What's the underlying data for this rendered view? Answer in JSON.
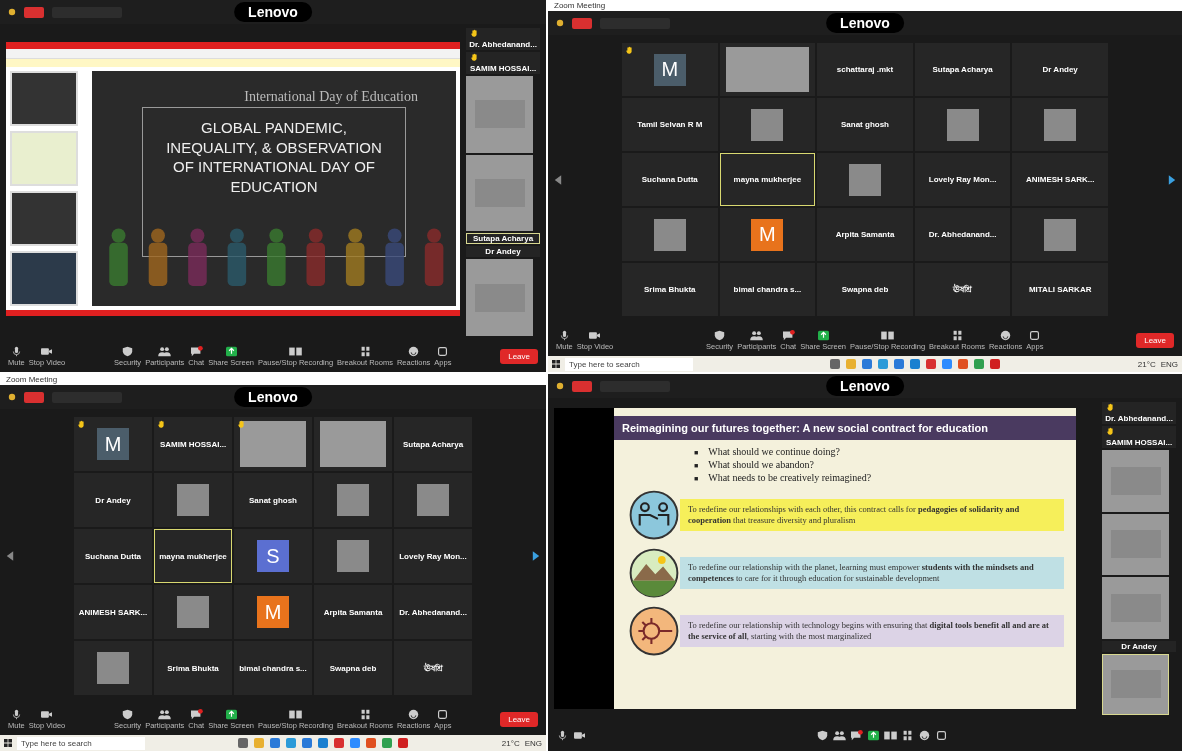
{
  "panels": [
    {
      "kind": "presentation",
      "brand": "Lenovo",
      "slide": {
        "kicker": "International Day of Education",
        "heading": "GLOBAL PANDEMIC, INEQUALITY, & OBSERVATION OF INTERNATIONAL DAY OF EDUCATION"
      },
      "sidebar": [
        {
          "kind": "name",
          "name": "Dr. Abhedanand...",
          "hand": true,
          "selected": false
        },
        {
          "kind": "name",
          "name": "SAMIM HOSSAI...",
          "hand": true,
          "selected": false
        },
        {
          "kind": "video",
          "hand": false,
          "selected": false
        },
        {
          "kind": "video",
          "hand": false,
          "selected": false
        },
        {
          "kind": "name",
          "name": "Sutapa Acharya",
          "hand": false,
          "selected": true
        },
        {
          "kind": "name",
          "name": "Dr Andey",
          "hand": false,
          "selected": false
        },
        {
          "kind": "video",
          "hand": false,
          "selected": false
        }
      ],
      "toolbar": [
        "Mute",
        "Stop Video",
        "Security",
        "Participants",
        "Chat",
        "Share Screen",
        "Pause/Stop Recording",
        "Breakout Rooms",
        "Reactions",
        "Apps"
      ],
      "leave": "Leave"
    },
    {
      "kind": "gallery",
      "title": "Zoom Meeting",
      "brand": "Lenovo",
      "tiles": [
        {
          "kind": "avatar",
          "letter": "M",
          "color": "#4b5d6a",
          "hand": true,
          "selected": false
        },
        {
          "kind": "video",
          "hand": false,
          "selected": false
        },
        {
          "kind": "name",
          "name": "schattaraj .mkt",
          "hand": false,
          "selected": false
        },
        {
          "kind": "name",
          "name": "Sutapa Acharya",
          "hand": false,
          "selected": false
        },
        {
          "kind": "name",
          "name": "Dr Andey",
          "hand": false,
          "selected": false
        },
        {
          "kind": "name",
          "name": "Tamil Selvan R M",
          "hand": false,
          "selected": false
        },
        {
          "kind": "photo",
          "hand": false,
          "selected": false
        },
        {
          "kind": "name",
          "name": "Sanat ghosh",
          "hand": false,
          "selected": false
        },
        {
          "kind": "photo",
          "hand": false,
          "selected": false
        },
        {
          "kind": "photo",
          "hand": false,
          "selected": false
        },
        {
          "kind": "name",
          "name": "Suchana Dutta",
          "hand": false,
          "selected": false
        },
        {
          "kind": "name",
          "name": "mayna mukherjee",
          "hand": false,
          "selected": true
        },
        {
          "kind": "photo",
          "hand": false,
          "selected": false
        },
        {
          "kind": "name",
          "name": "Lovely Ray Mon...",
          "hand": false,
          "selected": false
        },
        {
          "kind": "name",
          "name": "ANIMESH SARK...",
          "hand": false,
          "selected": false
        },
        {
          "kind": "photo",
          "hand": false,
          "selected": false
        },
        {
          "kind": "avatar",
          "letter": "M",
          "color": "#e8731c",
          "hand": false,
          "selected": false
        },
        {
          "kind": "name",
          "name": "Arpita Samanta",
          "hand": false,
          "selected": false
        },
        {
          "kind": "name",
          "name": "Dr. Abhedanand...",
          "hand": false,
          "selected": false
        },
        {
          "kind": "photo",
          "hand": false,
          "selected": false
        },
        {
          "kind": "name",
          "name": "Srima Bhukta",
          "hand": false,
          "selected": false
        },
        {
          "kind": "name",
          "name": "bimal chandra s...",
          "hand": false,
          "selected": false
        },
        {
          "kind": "name",
          "name": "Swapna deb",
          "hand": false,
          "selected": false
        },
        {
          "kind": "name",
          "name": "ঊষশ্রি",
          "hand": false,
          "selected": false
        },
        {
          "kind": "name",
          "name": "MITALI SARKAR",
          "hand": false,
          "selected": false
        }
      ],
      "toolbar": [
        "Mute",
        "Stop Video",
        "Security",
        "Participants",
        "Chat",
        "Share Screen",
        "Pause/Stop Recording",
        "Breakout Rooms",
        "Reactions",
        "Apps"
      ],
      "leave": "Leave",
      "taskbar": {
        "search": "Type here to search",
        "weather": "21°C",
        "language": "ENG"
      }
    },
    {
      "kind": "gallery",
      "title": "Zoom Meeting",
      "brand": "Lenovo",
      "tiles": [
        {
          "kind": "avatar",
          "letter": "M",
          "color": "#4b5d6a",
          "hand": true,
          "selected": false
        },
        {
          "kind": "name",
          "name": "SAMIM HOSSAI...",
          "hand": true,
          "selected": false
        },
        {
          "kind": "video",
          "hand": true,
          "selected": false
        },
        {
          "kind": "video",
          "hand": false,
          "selected": false
        },
        {
          "kind": "name",
          "name": "Sutapa Acharya",
          "hand": false,
          "selected": false
        },
        {
          "kind": "name",
          "name": "Dr Andey",
          "hand": false,
          "selected": false
        },
        {
          "kind": "photo",
          "hand": false,
          "selected": false
        },
        {
          "kind": "name",
          "name": "Sanat ghosh",
          "hand": false,
          "selected": false
        },
        {
          "kind": "photo",
          "hand": false,
          "selected": false
        },
        {
          "kind": "photo",
          "hand": false,
          "selected": false
        },
        {
          "kind": "name",
          "name": "Suchana Dutta",
          "hand": false,
          "selected": false
        },
        {
          "kind": "name",
          "name": "mayna mukherjee",
          "hand": false,
          "selected": true
        },
        {
          "kind": "avatar",
          "letter": "S",
          "color": "#5b6fd1",
          "hand": false,
          "selected": false
        },
        {
          "kind": "photo",
          "hand": false,
          "selected": false
        },
        {
          "kind": "name",
          "name": "Lovely Ray Mon...",
          "hand": false,
          "selected": false
        },
        {
          "kind": "name",
          "name": "ANIMESH SARK...",
          "hand": false,
          "selected": false
        },
        {
          "kind": "photo",
          "hand": false,
          "selected": false
        },
        {
          "kind": "avatar",
          "letter": "M",
          "color": "#e8731c",
          "hand": false,
          "selected": false
        },
        {
          "kind": "name",
          "name": "Arpita Samanta",
          "hand": false,
          "selected": false
        },
        {
          "kind": "name",
          "name": "Dr. Abhedanand...",
          "hand": false,
          "selected": false
        },
        {
          "kind": "photo",
          "hand": false,
          "selected": false
        },
        {
          "kind": "name",
          "name": "Srima Bhukta",
          "hand": false,
          "selected": false
        },
        {
          "kind": "name",
          "name": "bimal chandra s...",
          "hand": false,
          "selected": false
        },
        {
          "kind": "name",
          "name": "Swapna deb",
          "hand": false,
          "selected": false
        },
        {
          "kind": "name",
          "name": "ঊষশ্রি",
          "hand": false,
          "selected": false
        }
      ],
      "toolbar": [
        "Mute",
        "Stop Video",
        "Security",
        "Participants",
        "Chat",
        "Share Screen",
        "Pause/Stop Recording",
        "Breakout Rooms",
        "Reactions",
        "Apps"
      ],
      "leave": "Leave",
      "taskbar": {
        "search": "Type here to search",
        "weather": "21°C",
        "language": "ENG"
      }
    },
    {
      "kind": "slide",
      "brand": "Lenovo",
      "slide": {
        "heading": "Reimagining our futures together: A new social contract for education",
        "bullets": [
          {
            "marker": "■",
            "text": "What should we continue doing?"
          },
          {
            "marker": "■",
            "text": "What should we abandon?"
          },
          {
            "marker": "■",
            "text": "What needs to be creatively reimagined?"
          }
        ],
        "rows": [
          {
            "color": "#f6ef5a",
            "text": "To redefine our relationships with each other, this contract calls for **pedagogies of solidarity and cooperation** that treasure diversity and pluralism"
          },
          {
            "color": "#bfe0e4",
            "text": "To redefine our relationship with the planet, learning must empower **students with the mindsets and competences** to care for it through education for sustainable development"
          },
          {
            "color": "#dcd3e6",
            "text": "To redefine our relationship with technology begins with ensuring that **digital tools benefit all and are at the service of all**, starting with the most marginalized"
          }
        ]
      },
      "sidebar": [
        {
          "kind": "name",
          "name": "Dr. Abhedanand...",
          "hand": true,
          "selected": false
        },
        {
          "kind": "name",
          "name": "SAMIM HOSSAI...",
          "hand": true,
          "selected": false
        },
        {
          "kind": "video",
          "hand": false,
          "selected": false
        },
        {
          "kind": "video",
          "hand": false,
          "selected": false
        },
        {
          "kind": "video",
          "hand": false,
          "selected": false
        },
        {
          "kind": "name",
          "name": "Dr Andey",
          "hand": false,
          "selected": false
        },
        {
          "kind": "video",
          "hand": false,
          "selected": true
        }
      ]
    }
  ]
}
